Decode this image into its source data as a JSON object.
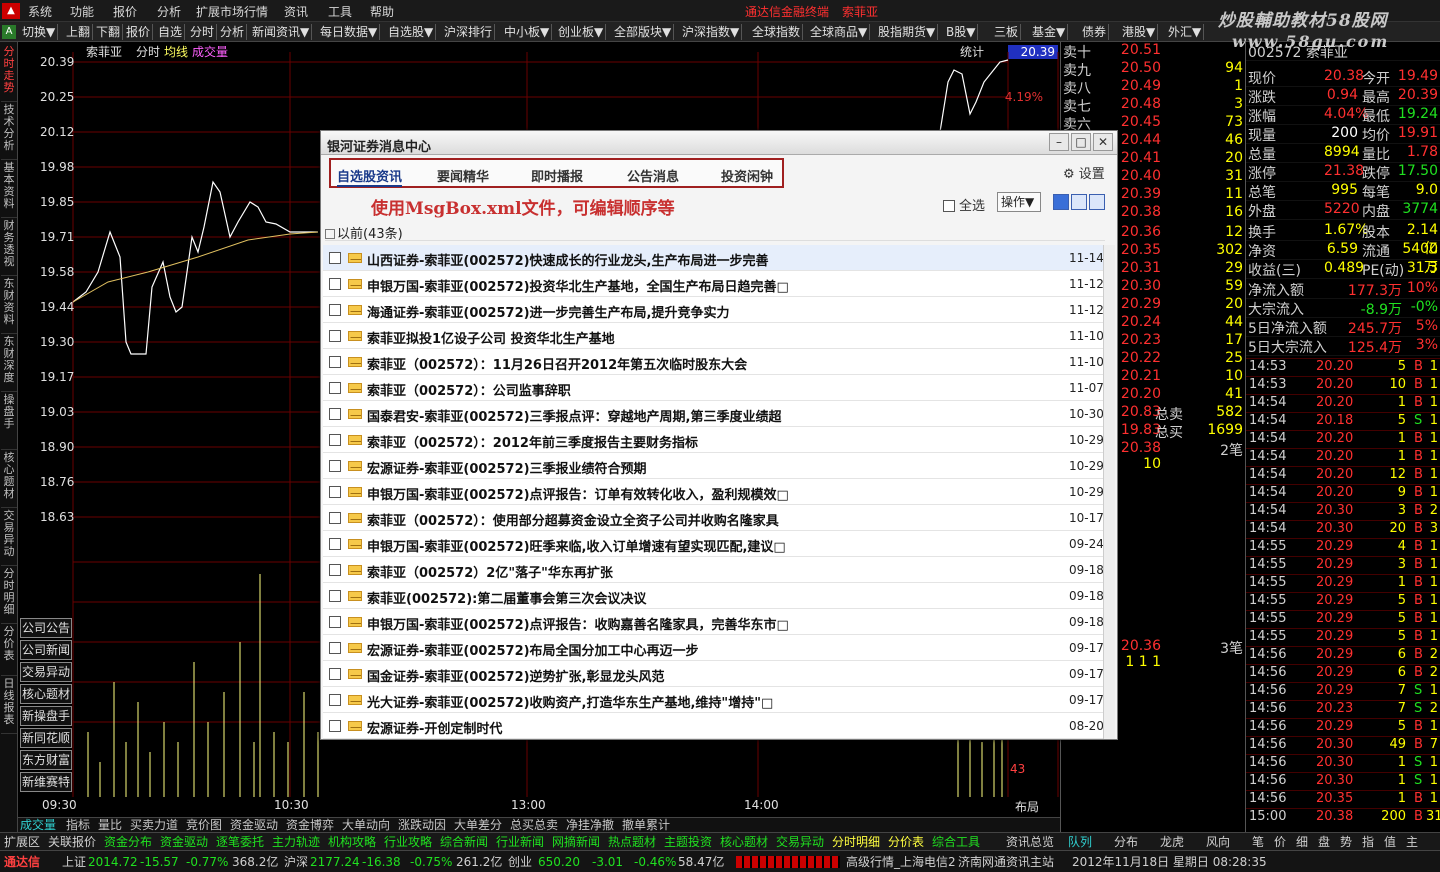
{
  "menu": {
    "items": [
      "系统",
      "功能",
      "报价",
      "分析",
      "扩展市场行情",
      "资讯",
      "工具",
      "帮助"
    ],
    "app_title": "通达信金融终端",
    "stock": "索菲亚"
  },
  "watermark": {
    "line1": "炒股輔助教材58股网",
    "line2": "www.58gu.com"
  },
  "toolbar": {
    "items": [
      "切换▼",
      "上翻",
      "下翻",
      "报价",
      "自选",
      "分时",
      "分析",
      "新闻资讯▼",
      "每日数据▼",
      "自选股▼",
      "沪深排行",
      "中小板▼",
      "创业板▼",
      "全部版块▼",
      "沪深指数▼",
      "全球指数",
      "全球商品▼",
      "股指期货▼",
      "B股▼",
      "三板",
      "基金▼",
      "债券",
      "港股▼",
      "外汇▼"
    ]
  },
  "left_tabs": [
    "分时走势",
    "技术分析",
    "基本资料",
    "财务透视",
    "东财资料",
    "东财深度",
    "操盘手",
    "核心题材",
    "交易异动",
    "分时明细",
    "分价表",
    "日线报表"
  ],
  "chart": {
    "header": {
      "name": "索菲亚",
      "mode": "分时",
      "avg": "均线",
      "vol": "成交量"
    },
    "stat_label": "统计",
    "price_box": "20.39",
    "left_prices": [
      "20.39",
      "20.25",
      "20.12",
      "19.98",
      "19.85",
      "19.71",
      "19.58",
      "19.44",
      "19.30",
      "19.17",
      "19.03",
      "18.90",
      "18.76",
      "18.63"
    ],
    "right_pct": [
      "4.19%"
    ],
    "times": [
      "09:30",
      "10:30",
      "13:00",
      "14:00"
    ],
    "layout_label": "布局",
    "vol_right": "43"
  },
  "vlinks": [
    "公司公告",
    "公司新闻",
    "交易异动",
    "核心题材",
    "新操盘手",
    "新同花顺",
    "东方财富",
    "新维赛特"
  ],
  "orderbook": {
    "sells": [
      {
        "label": "卖十",
        "price": "20.51",
        "vol": ""
      },
      {
        "label": "卖九",
        "price": "20.50",
        "vol": "94"
      },
      {
        "label": "卖八",
        "price": "20.49",
        "vol": "1"
      },
      {
        "label": "卖七",
        "price": "20.48",
        "vol": "3"
      },
      {
        "label": "卖六",
        "price": "20.45",
        "vol": "73"
      },
      {
        "label": "",
        "price": "20.44",
        "vol": "46"
      },
      {
        "label": "",
        "price": "20.41",
        "vol": "20"
      },
      {
        "label": "",
        "price": "20.40",
        "vol": "31"
      },
      {
        "label": "",
        "price": "20.39",
        "vol": "11"
      },
      {
        "label": "",
        "price": "20.38",
        "vol": "16"
      }
    ],
    "buys": [
      {
        "price": "20.36",
        "vol": "12"
      },
      {
        "price": "20.35",
        "vol": "302"
      },
      {
        "price": "20.31",
        "vol": "29"
      },
      {
        "price": "20.30",
        "vol": "59"
      },
      {
        "price": "20.29",
        "vol": "20"
      },
      {
        "price": "20.24",
        "vol": "44"
      },
      {
        "price": "20.23",
        "vol": "17"
      },
      {
        "price": "20.22",
        "vol": "25"
      },
      {
        "price": "20.21",
        "vol": "10"
      },
      {
        "price": "20.20",
        "vol": "41"
      }
    ],
    "sum": [
      {
        "p": "20.83",
        "l": "总卖",
        "v": "582"
      },
      {
        "p": "19.83",
        "l": "总买",
        "v": "1699"
      }
    ],
    "extra1": "20.38",
    "extra1b": "2笔",
    "extra2": "10",
    "extra3": "20.36",
    "extra3b": "3笔",
    "extra4": "1 1 1"
  },
  "quote": [
    {
      "l": "现价",
      "v": "20.38",
      "l2": "今开",
      "v2": "19.49"
    },
    {
      "l": "涨跌",
      "v": "0.94",
      "l2": "最高",
      "v2": "20.39"
    },
    {
      "l": "涨幅",
      "v": "4.04%",
      "l2": "最低",
      "v2": "19.24"
    },
    {
      "l": "现量",
      "v": "200",
      "l2": "均价",
      "v2": "19.91"
    },
    {
      "l": "总量",
      "v": "8994",
      "l2": "量比",
      "v2": "1.78"
    },
    {
      "l": "涨停",
      "v": "21.38",
      "l2": "跌停",
      "v2": "17.50"
    },
    {
      "l": "总笔",
      "v": "995",
      "l2": "每笔",
      "v2": "9.0"
    },
    {
      "l": "外盘",
      "v": "5220",
      "l2": "内盘",
      "v2": "3774"
    },
    {
      "l": "换手",
      "v": "1.67%",
      "l2": "股本",
      "v2": "2.14亿"
    },
    {
      "l": "净资",
      "v": "6.59",
      "l2": "流通",
      "v2": "5400万"
    },
    {
      "l": "收益(三)",
      "v": "0.489",
      "l2": "PE(动)",
      "v2": "31.3"
    },
    {
      "l": "净流入额",
      "v": "177.3万",
      "l2": "",
      "v2": "10%"
    },
    {
      "l": "大宗流入",
      "v": "-8.9万",
      "l2": "",
      "v2": "-0%"
    },
    {
      "l": "5日净流入额",
      "v": "245.7万",
      "l2": "",
      "v2": "5%"
    },
    {
      "l": "5日大宗流入",
      "v": "125.4万",
      "l2": "",
      "v2": "3%"
    }
  ],
  "code_top": "002572 索菲亚",
  "ticks": [
    {
      "t": "14:53",
      "p": "20.20",
      "v": "5",
      "f": "B",
      "n": "1"
    },
    {
      "t": "14:53",
      "p": "20.20",
      "v": "10",
      "f": "B",
      "n": "1"
    },
    {
      "t": "14:54",
      "p": "20.20",
      "v": "1",
      "f": "B",
      "n": "1"
    },
    {
      "t": "14:54",
      "p": "20.18",
      "v": "5",
      "f": "S",
      "n": "1"
    },
    {
      "t": "14:54",
      "p": "20.20",
      "v": "1",
      "f": "B",
      "n": "1"
    },
    {
      "t": "14:54",
      "p": "20.20",
      "v": "1",
      "f": "B",
      "n": "1"
    },
    {
      "t": "14:54",
      "p": "20.20",
      "v": "12",
      "f": "B",
      "n": "1"
    },
    {
      "t": "14:54",
      "p": "20.20",
      "v": "9",
      "f": "B",
      "n": "1"
    },
    {
      "t": "14:54",
      "p": "20.30",
      "v": "3",
      "f": "B",
      "n": "2"
    },
    {
      "t": "14:54",
      "p": "20.30",
      "v": "20",
      "f": "B",
      "n": "3"
    },
    {
      "t": "14:55",
      "p": "20.29",
      "v": "4",
      "f": "B",
      "n": "1"
    },
    {
      "t": "14:55",
      "p": "20.29",
      "v": "3",
      "f": "B",
      "n": "1"
    },
    {
      "t": "14:55",
      "p": "20.29",
      "v": "1",
      "f": "B",
      "n": "1"
    },
    {
      "t": "14:55",
      "p": "20.29",
      "v": "5",
      "f": "B",
      "n": "1"
    },
    {
      "t": "14:55",
      "p": "20.29",
      "v": "5",
      "f": "B",
      "n": "1"
    },
    {
      "t": "14:55",
      "p": "20.29",
      "v": "5",
      "f": "B",
      "n": "1"
    },
    {
      "t": "14:56",
      "p": "20.29",
      "v": "6",
      "f": "B",
      "n": "2"
    },
    {
      "t": "14:56",
      "p": "20.29",
      "v": "6",
      "f": "B",
      "n": "2"
    },
    {
      "t": "14:56",
      "p": "20.29",
      "v": "7",
      "f": "S",
      "n": "1"
    },
    {
      "t": "14:56",
      "p": "20.23",
      "v": "7",
      "f": "S",
      "n": "2"
    },
    {
      "t": "14:56",
      "p": "20.29",
      "v": "5",
      "f": "B",
      "n": "1"
    },
    {
      "t": "14:56",
      "p": "20.30",
      "v": "49",
      "f": "B",
      "n": "7"
    },
    {
      "t": "14:56",
      "p": "20.30",
      "v": "1",
      "f": "S",
      "n": "1"
    },
    {
      "t": "14:56",
      "p": "20.30",
      "v": "1",
      "f": "S",
      "n": "1"
    },
    {
      "t": "14:56",
      "p": "20.35",
      "v": "1",
      "f": "B",
      "n": "1"
    },
    {
      "t": "15:00",
      "p": "20.38",
      "v": "200",
      "f": "B",
      "n": "31"
    }
  ],
  "bottom_tabs": [
    "成交量",
    "指标",
    "量比",
    "买卖力道",
    "竞价图",
    "资金驱动",
    "资金博弈",
    "大单动向",
    "涨跌动因",
    "大单差分",
    "总买总卖",
    "净挂净撤",
    "撤单累计"
  ],
  "nav_tabs": [
    "扩展区",
    "关联报价",
    "资金分布",
    "资金驱动",
    "逐笔委托",
    "主力轨迹",
    "机构攻略",
    "行业攻略",
    "综合新闻",
    "行业新闻",
    "网摘新闻",
    "热点题材",
    "主题投资",
    "核心题材",
    "交易异动",
    "分时明细",
    "分价表",
    "综合工具",
    "资讯总览"
  ],
  "right_nav": [
    "队列",
    "分布",
    "龙虎",
    "风向",
    "笔",
    "价",
    "细",
    "盘",
    "势",
    "指",
    "值",
    "主"
  ],
  "status": {
    "app": "通达信",
    "sh_label": "上证",
    "sh": "2014.72",
    "sh_chg": "-15.57",
    "sh_pct": "-0.77%",
    "sh_amt": "368.2亿",
    "hs_label": "沪深",
    "hs": "2177.24",
    "hs_chg": "-16.38",
    "hs_pct": "-0.75%",
    "hs_amt": "261.2亿",
    "cy_label": "创业",
    "cy": "650.20",
    "cy_chg": "-3.01",
    "cy_pct": "-0.46%",
    "cy_amt": "58.47亿",
    "server": "高级行情_上海电信2",
    "news": "济南网通资讯主站",
    "date": "2012年11月18日 星期日 08:28:35"
  },
  "dialog": {
    "title": "银河证券消息中心",
    "tabs": [
      "自选股资讯",
      "要闻精华",
      "即时播报",
      "公告消息",
      "投资闲钟"
    ],
    "settings": "设置",
    "note": "使用MsgBox.xml文件，可编辑顺序等",
    "select_all": "全选",
    "operate": "操作▼",
    "group": "以前(43条)",
    "items": [
      {
        "text": "山西证券-索菲亚(002572)快速成长的行业龙头,生产布局进一步完善",
        "date": "11-14"
      },
      {
        "text": "申银万国-索菲亚(002572)投资华北生产基地，全国生产布局日趋完善□",
        "date": "11-12"
      },
      {
        "text": "海通证券-索菲亚(002572)进一步完善生产布局,提升竞争实力",
        "date": "11-12"
      },
      {
        "text": "索菲亚拟投1亿设子公司 投资华北生产基地",
        "date": "11-10"
      },
      {
        "text": "索菲亚（002572）：11月26日召开2012年第五次临时股东大会",
        "date": "11-10"
      },
      {
        "text": "索菲亚（002572）：公司监事辞职",
        "date": "11-07"
      },
      {
        "text": "国泰君安-索菲亚(002572)三季报点评：穿越地产周期,第三季度业绩超",
        "date": "10-30"
      },
      {
        "text": "索菲亚（002572）：2012年前三季度报告主要财务指标",
        "date": "10-29"
      },
      {
        "text": "宏源证券-索菲亚(002572)三季报业绩符合预期",
        "date": "10-29"
      },
      {
        "text": "申银万国-索菲亚(002572)点评报告：订单有效转化收入，盈利规模效□",
        "date": "10-29"
      },
      {
        "text": "索菲亚（002572）：使用部分超募资金设立全资子公司并收购名隆家具",
        "date": "10-17"
      },
      {
        "text": "申银万国-索菲亚(002572)旺季来临,收入订单增速有望实现匹配,建议□",
        "date": "09-24"
      },
      {
        "text": "索菲亚（002572）2亿\"落子\"华东再扩张",
        "date": "09-18"
      },
      {
        "text": "索菲亚(002572):第二届董事会第三次会议决议",
        "date": "09-18"
      },
      {
        "text": "申银万国-索菲亚(002572)点评报告：收购嘉善名隆家具，完善华东市□",
        "date": "09-18"
      },
      {
        "text": "宏源证券-索菲亚(002572)布局全国分加工中心再迈一步",
        "date": "09-17"
      },
      {
        "text": "国金证券-索菲亚(002572)逆势扩张,彰显龙头风范",
        "date": "09-17"
      },
      {
        "text": "光大证券-索菲亚(002572)收购资产,打造华东生产基地,维持\"增持\"□",
        "date": "09-17"
      },
      {
        "text": "宏源证券-开创定制时代",
        "date": "08-20"
      }
    ]
  }
}
